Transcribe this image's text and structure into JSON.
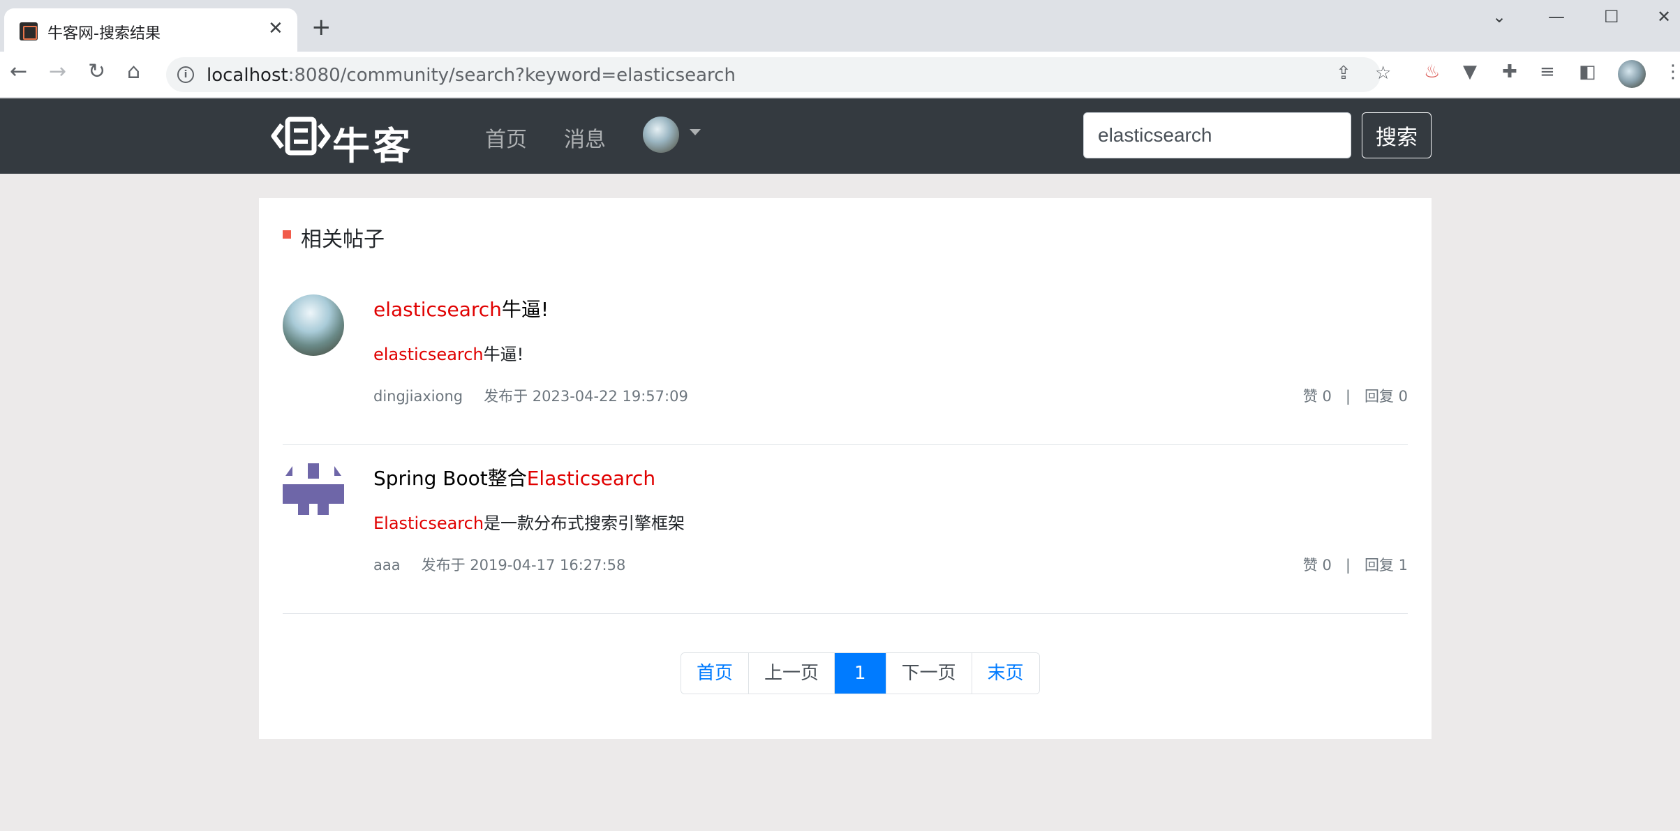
{
  "browser": {
    "tab_title": "牛客网-搜索结果",
    "url_host": "localhost",
    "url_rest": ":8080/community/search?keyword=elasticsearch"
  },
  "header": {
    "logo_text": "牛客",
    "nav": [
      "首页",
      "消息"
    ],
    "search_value": "elasticsearch",
    "search_button": "搜索"
  },
  "section": {
    "title": "相关帖子"
  },
  "posts": [
    {
      "title_hl": "elasticsearch",
      "title_rest": "牛逼!",
      "body_hl": "elasticsearch",
      "body_rest": "牛逼!",
      "author": "dingjiaxiong",
      "time": "发布于 2023-04-22 19:57:09",
      "likes": "赞 0",
      "replies": "回复 0"
    },
    {
      "title_pre": "Spring Boot整合",
      "title_hl": "Elasticsearch",
      "body_hl": "Elasticsearch",
      "body_rest": "是一款分布式搜索引擎框架",
      "author": "aaa",
      "time": "发布于 2019-04-17 16:27:58",
      "likes": "赞 0",
      "replies": "回复 1"
    }
  ],
  "pagination": {
    "first": "首页",
    "prev": "上一页",
    "current": "1",
    "next": "下一页",
    "last": "末页"
  },
  "colors": {
    "header_bg": "#343a40",
    "highlight": "#e00000",
    "accent": "#007bff",
    "section_mark": "#f15b4a"
  }
}
